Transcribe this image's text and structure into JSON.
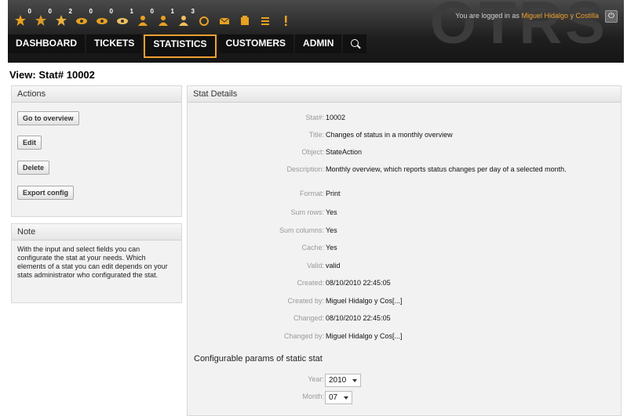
{
  "header": {
    "login_prefix": "You are logged in as",
    "login_user": "Miguel Hidalgo y Costilla",
    "logo": "OTRS"
  },
  "toolbar": [
    {
      "icon": "locked-tickets-icon",
      "count": "0"
    },
    {
      "icon": "locked-new-tickets-icon",
      "count": "0"
    },
    {
      "icon": "locked-reminder-tickets-icon",
      "count": "2"
    },
    {
      "icon": "watched-tickets-icon",
      "count": "0"
    },
    {
      "icon": "watched-new-tickets-icon",
      "count": "0"
    },
    {
      "icon": "watched-reminder-tickets-icon",
      "count": "1"
    },
    {
      "icon": "responsible-tickets-icon",
      "count": "0"
    },
    {
      "icon": "responsible-new-tickets-icon",
      "count": "1"
    },
    {
      "icon": "responsible-reminder-tickets-icon",
      "count": "3"
    },
    {
      "icon": "queue-view-icon",
      "count": ""
    },
    {
      "icon": "new-email-ticket-icon",
      "count": ""
    },
    {
      "icon": "new-phone-ticket-icon",
      "count": ""
    },
    {
      "icon": "status-view-icon",
      "count": ""
    },
    {
      "icon": "escalation-view-icon",
      "count": ""
    }
  ],
  "nav": {
    "items": [
      "DASHBOARD",
      "TICKETS",
      "STATISTICS",
      "CUSTOMERS",
      "ADMIN"
    ],
    "active": "STATISTICS"
  },
  "page": {
    "title": "View: Stat# 10002"
  },
  "actions": {
    "heading": "Actions",
    "buttons": [
      "Go to overview",
      "Edit",
      "Delete",
      "Export config"
    ]
  },
  "note": {
    "heading": "Note",
    "text": "With the input and select fields you can configurate the stat at your needs. Which elements of a stat you can edit depends on your stats administrator who configurated the stat."
  },
  "details": {
    "heading": "Stat Details",
    "fields": [
      {
        "label": "Stat#:",
        "value": "10002"
      },
      {
        "label": "Title:",
        "value": "Changes of status in a monthly overview"
      },
      {
        "label": "Object:",
        "value": "StateAction"
      },
      {
        "label": "Description:",
        "value": "Monthly overview, which reports status changes per day of a selected month."
      },
      {
        "label": "Format:",
        "value": "Print"
      },
      {
        "label": "Sum rows:",
        "value": "Yes"
      },
      {
        "label": "Sum columns:",
        "value": "Yes"
      },
      {
        "label": "Cache:",
        "value": "Yes"
      },
      {
        "label": "Valid:",
        "value": "valid"
      },
      {
        "label": "Created:",
        "value": "08/10/2010 22:45:05"
      },
      {
        "label": "Created by:",
        "value": "Miguel Hidalgo y Cos[...]"
      },
      {
        "label": "Changed:",
        "value": "08/10/2010 22:45:05"
      },
      {
        "label": "Changed by:",
        "value": "Miguel Hidalgo y Cos[...]"
      }
    ],
    "params_heading": "Configurable params of static stat",
    "params": [
      {
        "label": "Year:",
        "value": "2010"
      },
      {
        "label": "Month:",
        "value": "07"
      }
    ]
  },
  "colors": {
    "accent": "#f0a030",
    "header_bg": "#1f1f1f",
    "panel_bg": "#f2f2f2"
  }
}
